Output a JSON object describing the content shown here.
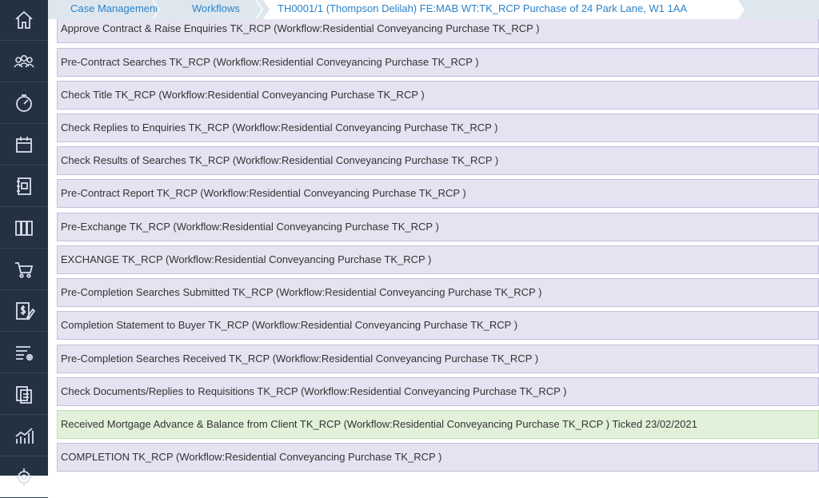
{
  "breadcrumb": {
    "items": [
      "Case Management",
      "Workflows",
      "TH0001/1 (Thompson Delilah) FE:MAB WT:TK_RCP Purchase of 24 Park Lane, W1 1AA"
    ]
  },
  "sidebar": {
    "icons": [
      "home-icon",
      "people-icon",
      "dashboard-icon",
      "calendar-icon",
      "address-book-icon",
      "library-icon",
      "cart-icon",
      "billing-icon",
      "settings-list-icon",
      "documents-icon",
      "reports-icon",
      "gear-icon"
    ]
  },
  "tasks": [
    {
      "label": "Approve Contract & Raise Enquiries TK_RCP (Workflow:Residential Conveyancing Purchase TK_RCP )",
      "status": "open"
    },
    {
      "label": "Pre-Contract Searches TK_RCP (Workflow:Residential Conveyancing Purchase TK_RCP )",
      "status": "open"
    },
    {
      "label": "Check Title TK_RCP (Workflow:Residential Conveyancing Purchase TK_RCP )",
      "status": "open"
    },
    {
      "label": "Check Replies to Enquiries TK_RCP (Workflow:Residential Conveyancing Purchase TK_RCP )",
      "status": "open"
    },
    {
      "label": "Check Results of Searches TK_RCP (Workflow:Residential Conveyancing Purchase TK_RCP )",
      "status": "open"
    },
    {
      "label": "Pre-Contract Report TK_RCP (Workflow:Residential Conveyancing Purchase TK_RCP )",
      "status": "open"
    },
    {
      "label": "Pre-Exchange TK_RCP (Workflow:Residential Conveyancing Purchase TK_RCP )",
      "status": "open"
    },
    {
      "label": "EXCHANGE TK_RCP (Workflow:Residential Conveyancing Purchase TK_RCP )",
      "status": "open"
    },
    {
      "label": "Pre-Completion Searches Submitted TK_RCP (Workflow:Residential Conveyancing Purchase TK_RCP )",
      "status": "open"
    },
    {
      "label": "Completion Statement to Buyer TK_RCP (Workflow:Residential Conveyancing Purchase TK_RCP )",
      "status": "open"
    },
    {
      "label": "Pre-Completion Searches Received TK_RCP (Workflow:Residential Conveyancing Purchase TK_RCP )",
      "status": "open"
    },
    {
      "label": "Check Documents/Replies to Requisitions TK_RCP (Workflow:Residential Conveyancing Purchase TK_RCP )",
      "status": "open"
    },
    {
      "label": "Received Mortgage Advance & Balance from Client TK_RCP (Workflow:Residential Conveyancing Purchase TK_RCP ) Ticked 23/02/2021",
      "status": "ticked"
    },
    {
      "label": "COMPLETION TK_RCP (Workflow:Residential Conveyancing Purchase TK_RCP )",
      "status": "open"
    }
  ]
}
